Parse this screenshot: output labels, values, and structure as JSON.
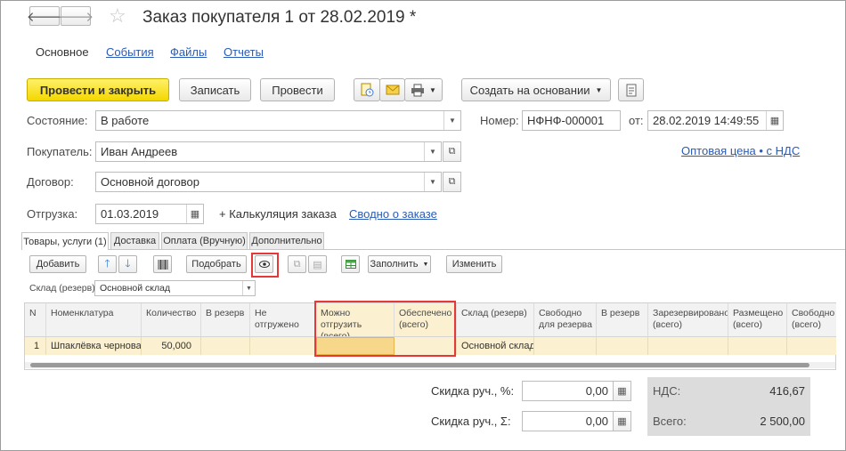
{
  "header": {
    "title": "Заказ покупателя 1 от 28.02.2019 *",
    "back_icon": "arrow-left-icon",
    "forward_icon": "arrow-right-icon",
    "favorite_icon": "star-icon"
  },
  "nav": {
    "main": "Основное",
    "events": "События",
    "files": "Файлы",
    "reports": "Отчеты"
  },
  "toolbar": {
    "post_close": "Провести и закрыть",
    "save": "Записать",
    "post": "Провести",
    "create_based": "Создать на основании"
  },
  "form": {
    "state_label": "Состояние:",
    "state_value": "В работе",
    "number_label": "Номер:",
    "number_value": "НФНФ-000001",
    "date_label": "от:",
    "date_value": "28.02.2019 14:49:55",
    "buyer_label": "Покупатель:",
    "buyer_value": "Иван Андреев",
    "price_link": "Оптовая цена • с НДС",
    "contract_label": "Договор:",
    "contract_value": "Основной договор",
    "shipment_label": "Отгрузка:",
    "shipment_value": "01.03.2019",
    "calc_text": "+ Калькуляция заказа",
    "summary_link": "Сводно о заказе"
  },
  "tabs": [
    "Товары, услуги (1)",
    "Доставка",
    "Оплата (Вручную)",
    "Дополнительно"
  ],
  "table_toolbar": {
    "add": "Добавить",
    "pick": "Подобрать",
    "fill": "Заполнить",
    "change": "Изменить",
    "warehouse_label": "Склад (резерв):",
    "warehouse_value": "Основной склад"
  },
  "table": {
    "headers": [
      "N",
      "Номенклатура",
      "Количество",
      "В резерв",
      "Не отгружено",
      "Можно отгрузить (всего)",
      "Обеспечено (всего)",
      "Склад (резерв)",
      "Свободно для резерва",
      "В резерв",
      "Зарезервировано (всего)",
      "Размещено (всего)",
      "Свободно (всего)"
    ],
    "rows": [
      [
        "1",
        "Шпаклёвка черновая",
        "50,000",
        "",
        "",
        "",
        "",
        "Основной склад",
        "",
        "",
        "",
        "",
        ""
      ]
    ]
  },
  "totals": {
    "discount_pct_label": "Скидка руч., %:",
    "discount_pct_value": "0,00",
    "discount_sum_label": "Скидка руч., Σ:",
    "discount_sum_value": "0,00",
    "vat_label": "НДС:",
    "vat_value": "416,67",
    "total_label": "Всего:",
    "total_value": "2 500,00"
  }
}
